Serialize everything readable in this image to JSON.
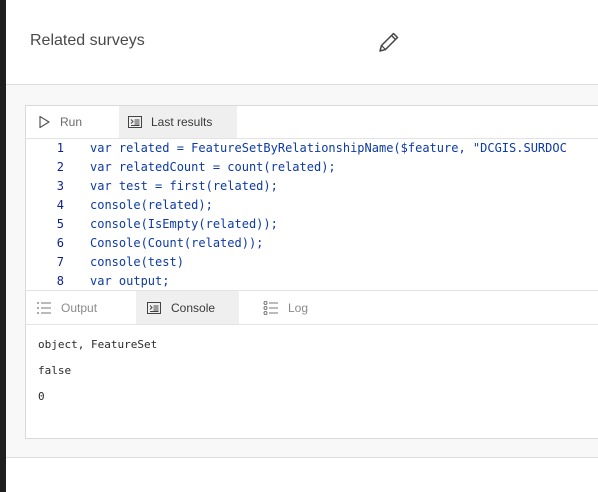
{
  "header": {
    "title": "Related surveys",
    "edit_icon": "pencil-icon"
  },
  "toolbar": {
    "run_label": "Run",
    "last_results_label": "Last results"
  },
  "code": {
    "lines": [
      {
        "num": "1",
        "text": "var related = FeatureSetByRelationshipName($feature, \"DCGIS.SURDOC"
      },
      {
        "num": "2",
        "text": "var relatedCount = count(related);"
      },
      {
        "num": "3",
        "text": "var test = first(related);"
      },
      {
        "num": "4",
        "text": "console(related);"
      },
      {
        "num": "5",
        "text": "console(IsEmpty(related));"
      },
      {
        "num": "6",
        "text": "Console(Count(related));"
      },
      {
        "num": "7",
        "text": "console(test)"
      },
      {
        "num": "8",
        "text": "var output;"
      }
    ]
  },
  "results_tabs": {
    "output_label": "Output",
    "console_label": "Console",
    "log_label": "Log"
  },
  "console": {
    "lines": [
      "object, FeatureSet",
      "false",
      "0"
    ]
  },
  "colors": {
    "code_text": "#0d3aa8",
    "line_number": "#0a1f8f",
    "active_tab_bg": "#efefef"
  }
}
